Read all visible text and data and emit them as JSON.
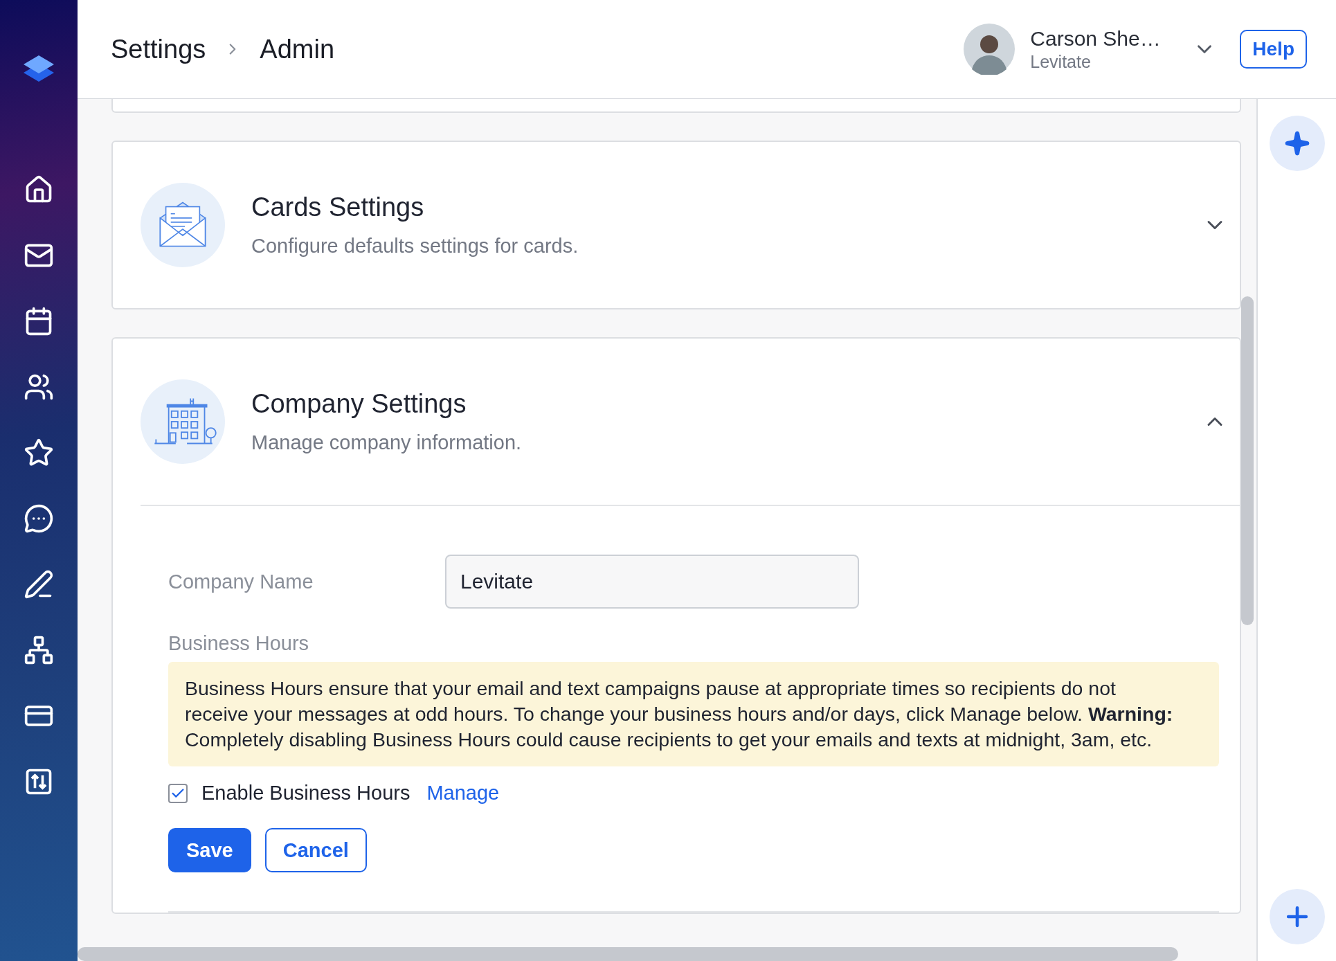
{
  "header": {
    "breadcrumbs": [
      "Settings",
      "Admin"
    ],
    "user": {
      "name": "Carson She…",
      "company": "Levitate"
    },
    "help_button": "Help"
  },
  "sections": [
    {
      "kind": "cards",
      "title": "Cards Settings",
      "subtitle": "Configure defaults settings for cards.",
      "expanded": false
    },
    {
      "kind": "company",
      "title": "Company Settings",
      "subtitle": "Manage company information.",
      "expanded": true
    }
  ],
  "company_form": {
    "company_name_label": "Company Name",
    "company_name_value": "Levitate",
    "business_hours_label": "Business Hours",
    "notice": "Business Hours ensure that your email and text campaigns pause at appropriate times so recipients do not receive your messages at odd hours. To change your business hours and/or days, click Manage below. **Warning:** Completely disabling Business Hours could cause recipients to get your emails and texts at midnight, 3am, etc.",
    "enable_checkbox": {
      "label": "Enable Business Hours",
      "checked": true
    },
    "manage_link": "Manage",
    "buttons": [
      "Save",
      "Cancel"
    ]
  }
}
